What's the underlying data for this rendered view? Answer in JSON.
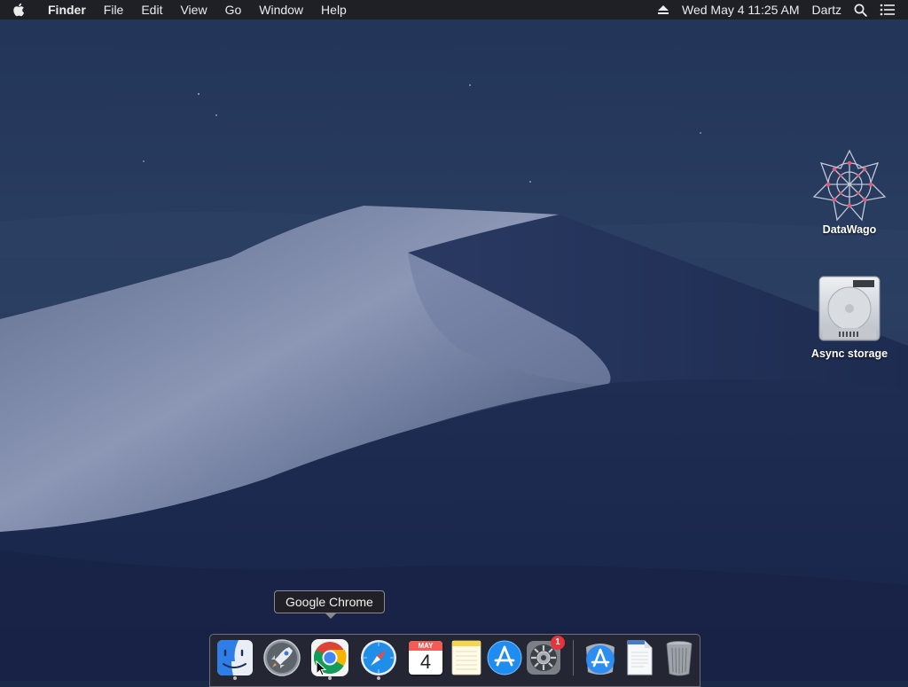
{
  "menubar": {
    "app_name": "Finder",
    "menus": [
      "File",
      "Edit",
      "View",
      "Go",
      "Window",
      "Help"
    ],
    "datetime": "Wed May 4  11:25 AM",
    "user": "Dartz"
  },
  "desktop": {
    "icons": [
      {
        "label": "DataWago",
        "icon": "datawago-app-icon"
      },
      {
        "label": "Async storage",
        "icon": "hard-drive-icon"
      }
    ]
  },
  "tooltip": {
    "text": "Google Chrome"
  },
  "dock": {
    "calendar": {
      "month": "MAY",
      "day": "4"
    },
    "system_preferences_badge": "1",
    "items": [
      "Finder",
      "Launchpad",
      "Google Chrome",
      "Safari",
      "Calendar",
      "Notes",
      "App Store",
      "System Preferences",
      "Applications",
      "Documents",
      "Trash"
    ]
  },
  "colors": {
    "menubar_bg": "#1e1e22",
    "sky_top": "#1f2f52",
    "dune_light": "#9aa5c4",
    "badge": "#e8333a"
  }
}
